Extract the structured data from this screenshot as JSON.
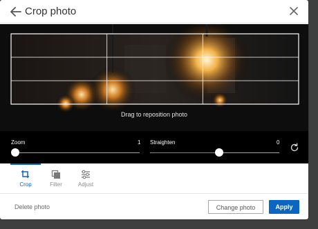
{
  "header": {
    "title": "Crop photo",
    "back_icon": "arrow-left-icon",
    "close_icon": "close-icon"
  },
  "photo": {
    "hint": "Drag to reposition photo"
  },
  "controls": {
    "zoom": {
      "label": "Zoom",
      "value": "1",
      "level": 0.0
    },
    "straighten": {
      "label": "Straighten",
      "value": "0",
      "level": 0.5
    },
    "reset_icon": "rotate-reset-icon"
  },
  "tabs": [
    {
      "label": "Crop",
      "icon": "crop-icon",
      "active": true
    },
    {
      "label": "Filter",
      "icon": "filter-icon",
      "active": false
    },
    {
      "label": "Adjust",
      "icon": "sliders-icon",
      "active": false
    }
  ],
  "footer": {
    "delete_label": "Delete photo",
    "change_label": "Change photo",
    "apply_label": "Apply"
  },
  "colors": {
    "accent": "#0a66c2",
    "controls_bg": "#000000",
    "page_bg": "#3f3f3f"
  }
}
